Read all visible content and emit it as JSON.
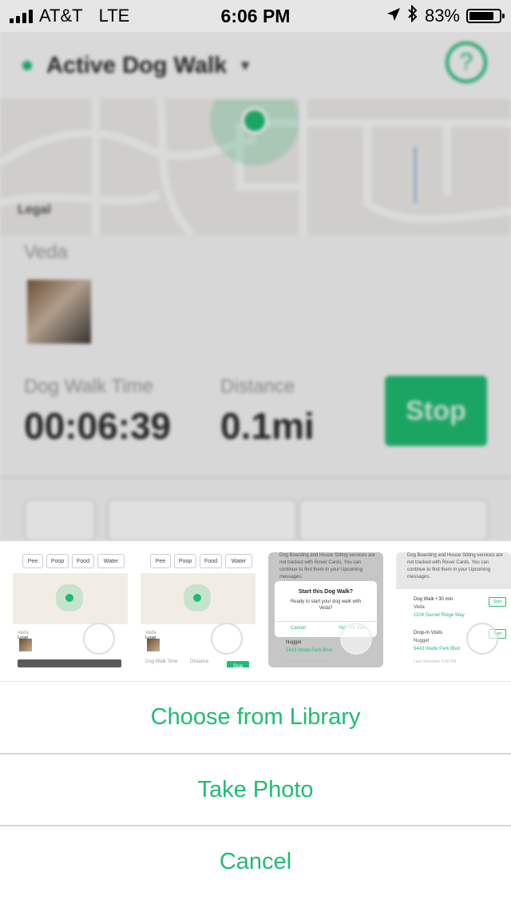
{
  "status_bar": {
    "carrier": "AT&T",
    "network": "LTE",
    "time": "6:06 PM",
    "battery": "83%",
    "battery_level": 0.83,
    "icons": [
      "signal-icon",
      "location-arrow-icon",
      "bluetooth-icon",
      "battery-icon"
    ]
  },
  "header": {
    "title": "Active Dog Walk",
    "help_label": "?"
  },
  "map": {
    "legal": "Legal"
  },
  "walk": {
    "dog_name": "Veda",
    "time_label": "Dog Walk Time",
    "time_value": "00:06:39",
    "distance_label": "Distance",
    "distance_value": "0.1mi",
    "stop_label": "Stop"
  },
  "thumbnails": {
    "pills": [
      "Pee",
      "Poop",
      "Food",
      "Water"
    ],
    "legal": "Legal",
    "dog_name": "Veda",
    "time_label": "Dog Walk Time",
    "distance_label": "Distance",
    "stop": "Stop",
    "dialog_header_text": "Dog Boarding and House Sitting services are not tracked with Rover Cards. You can continue to find them in your Upcoming messages.",
    "dialog_title": "Start this Dog Walk?",
    "dialog_message": "Ready to start your dog walk with Veda?",
    "dialog_cancel": "Cancel",
    "dialog_confirm": "Yes, I'm Sure",
    "nugget": "Nugget",
    "nugget_address": "5443 Wade Park Blvd",
    "last_refreshed": "Last refreshed: 5:46 PM",
    "list_header_text": "Dog Boarding and House Sitting services are not tracked with Rover Cards. You can continue to find them in your Upcoming messages.",
    "item1_title": "Dog Walk • 30 min",
    "item1_dog": "Veda",
    "item1_address": "1104 Garnet Ridge Way",
    "item2_title": "Drop-In Visits",
    "item2_dog": "Nugget",
    "item2_address": "5443 Wade Park Blvd",
    "start": "Start",
    "last_refreshed2": "Last refreshed: 5:46 PM"
  },
  "actions": {
    "choose_library": "Choose from Library",
    "take_photo": "Take Photo",
    "cancel": "Cancel"
  },
  "colors": {
    "accent": "#1fbc73"
  }
}
